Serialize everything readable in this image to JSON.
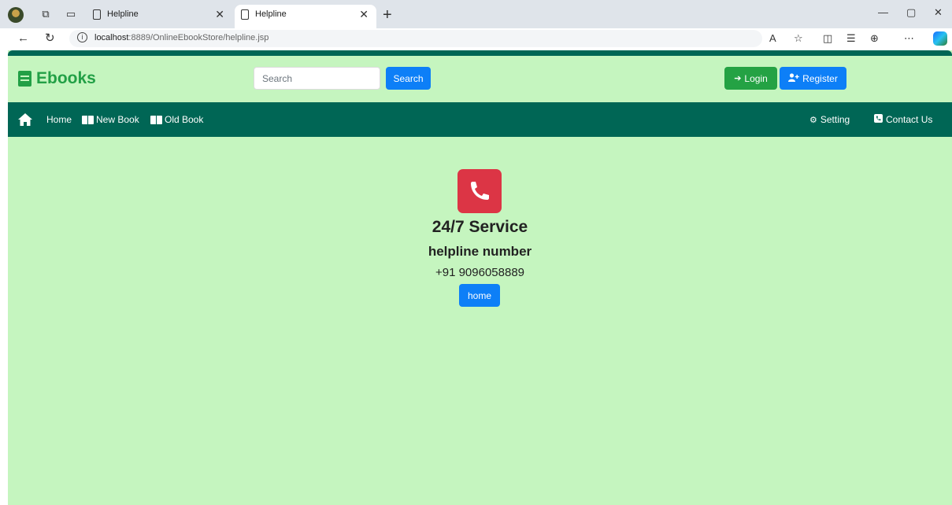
{
  "browser": {
    "tabs": [
      {
        "title": "Helpline",
        "active": false
      },
      {
        "title": "Helpline",
        "active": true
      }
    ],
    "url_host": "localhost",
    "url_path": ":8889/OnlineEbookStore/helpline.jsp"
  },
  "header": {
    "brand": "Ebooks",
    "search_placeholder": "Search",
    "search_button": "Search",
    "login_button": "Login",
    "register_button": "Register"
  },
  "navbar": {
    "home": "Home",
    "new_book": "New Book",
    "old_book": "Old Book",
    "setting": "Setting",
    "contact": "Contact Us"
  },
  "main": {
    "service_title": "24/7 Service",
    "helpline_label": "helpline number",
    "phone_number": "+91 9096058889",
    "home_button": "home"
  },
  "colors": {
    "page_bg": "#c5f5bf",
    "nav_bg": "#006655",
    "brand": "#22a046",
    "primary": "#0d7ff7",
    "success": "#24a244",
    "danger": "#dc3545"
  }
}
